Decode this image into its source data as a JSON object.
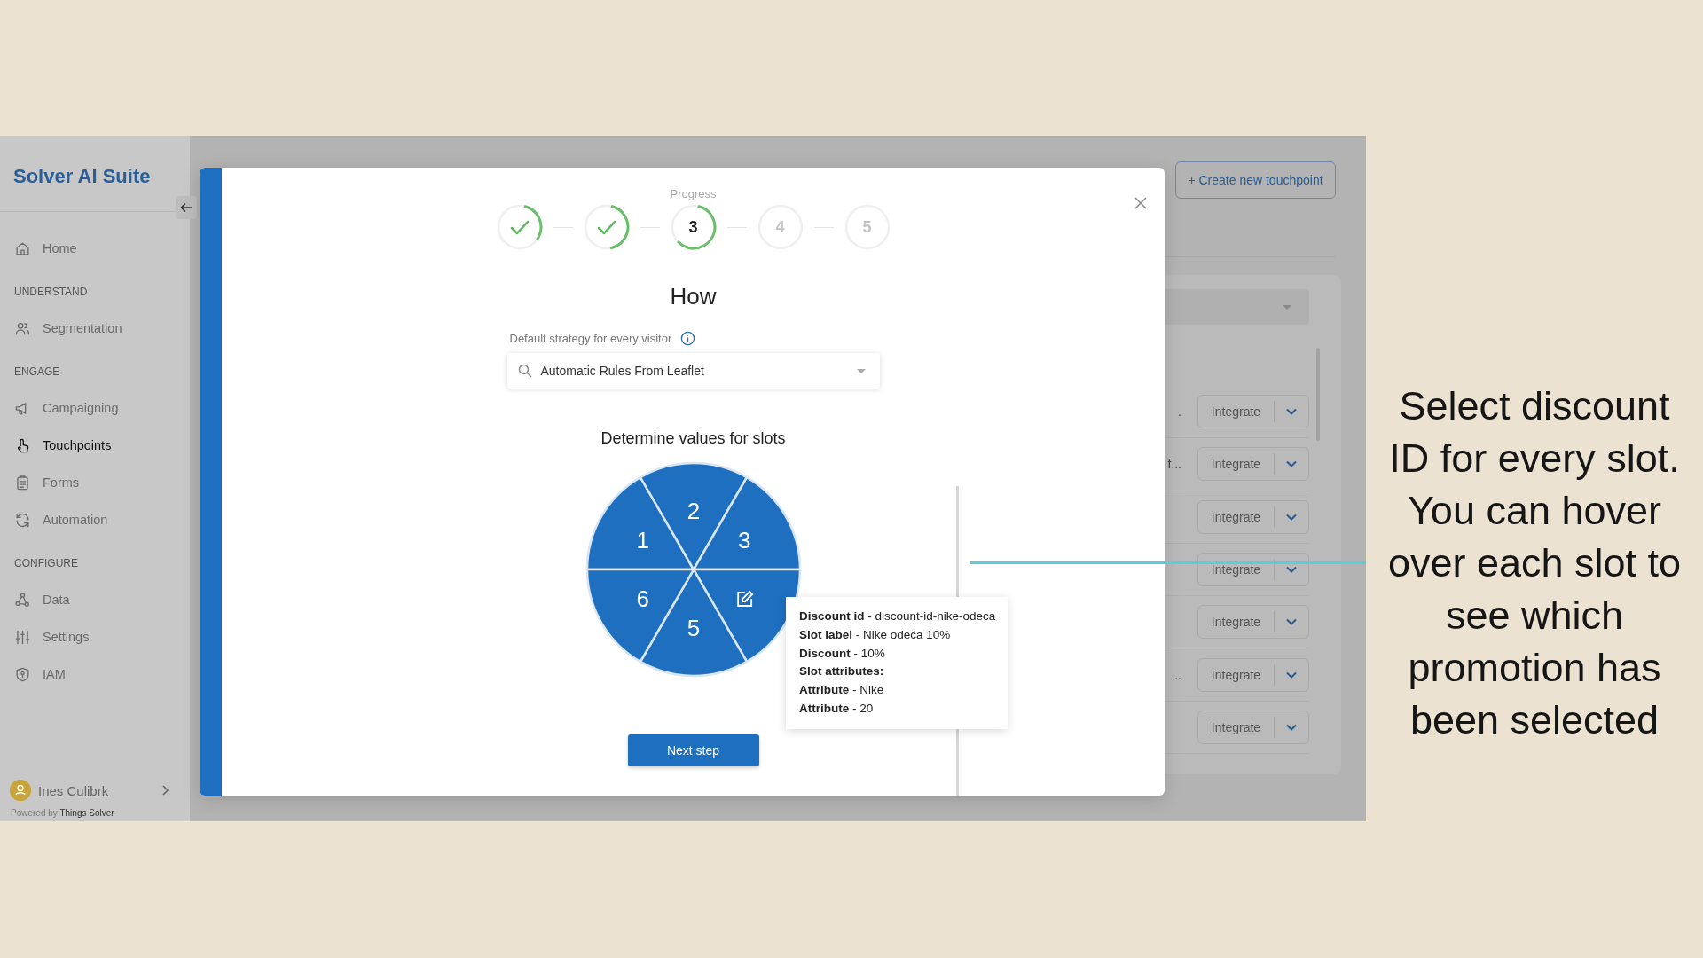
{
  "sidebar": {
    "title": "Solver AI Suite",
    "nav": [
      {
        "kind": "item",
        "label": "Home",
        "selected": false
      },
      {
        "kind": "header",
        "label": "UNDERSTAND"
      },
      {
        "kind": "item",
        "label": "Segmentation",
        "selected": false
      },
      {
        "kind": "header",
        "label": "ENGAGE"
      },
      {
        "kind": "item",
        "label": "Campaigning",
        "selected": false
      },
      {
        "kind": "item",
        "label": "Touchpoints",
        "selected": true
      },
      {
        "kind": "item",
        "label": "Forms",
        "selected": false
      },
      {
        "kind": "item",
        "label": "Automation",
        "selected": false
      },
      {
        "kind": "header",
        "label": "CONFIGURE"
      },
      {
        "kind": "item",
        "label": "Data",
        "selected": false
      },
      {
        "kind": "item",
        "label": "Settings",
        "selected": false
      },
      {
        "kind": "item",
        "label": "IAM",
        "selected": false
      }
    ],
    "user": {
      "name": "Ines Culibrk"
    },
    "footer": {
      "prefix": "Powered by",
      "link": "Things Solver"
    }
  },
  "main": {
    "create_button": "+ Create new touchpoint",
    "rows": [
      {
        "fragment": ".",
        "button": "Integrate"
      },
      {
        "fragment": "f...",
        "button": "Integrate"
      },
      {
        "button": "Integrate"
      },
      {
        "button": "Integrate"
      },
      {
        "button": "Integrate"
      },
      {
        "fragment": "..",
        "button": "Integrate"
      },
      {
        "button": "Integrate"
      }
    ]
  },
  "modal": {
    "progress_label": "Progress",
    "steps": [
      {
        "completed": true,
        "active": false
      },
      {
        "completed": true,
        "active": false
      },
      {
        "completed": false,
        "active": true,
        "label": "3"
      },
      {
        "completed": false,
        "active": false,
        "label": "4"
      },
      {
        "completed": false,
        "active": false,
        "label": "5"
      }
    ],
    "title": "How",
    "strategy_label": "Default strategy for every visitor",
    "strategy_value": "Automatic Rules From Leaflet",
    "slots_heading": "Determine values for slots",
    "slots": [
      {
        "kind": "number",
        "label": "1"
      },
      {
        "kind": "number",
        "label": "2"
      },
      {
        "kind": "number",
        "label": "3"
      },
      {
        "kind": "edit"
      },
      {
        "kind": "number",
        "label": "5"
      },
      {
        "kind": "number",
        "label": "6"
      }
    ],
    "tooltip": [
      "**Discount id** - discount-id-nike-odeca",
      "**Slot label** - Nike odeća 10%",
      "**Discount** - 10%",
      "**Slot attributes:**",
      "**Attribute** - Nike",
      "**Attribute** - 20"
    ],
    "next_button": "Next step"
  },
  "caption": "Select discount ID for every slot. You can hover over each slot to see which promotion has been selected"
}
